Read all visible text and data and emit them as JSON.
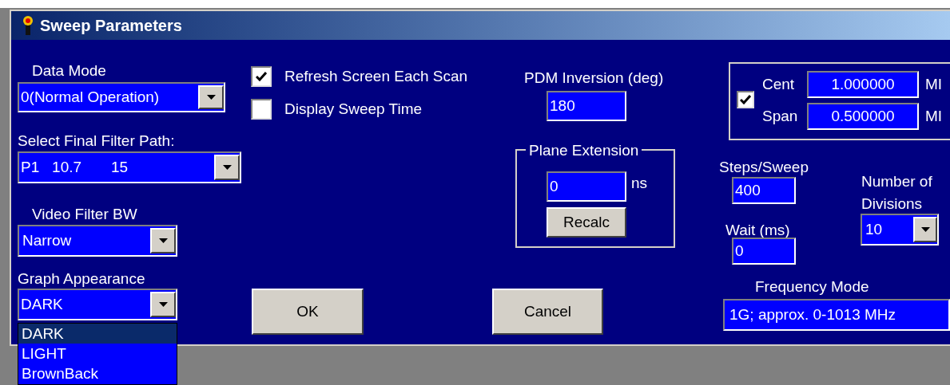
{
  "window": {
    "title": "Sweep Parameters"
  },
  "data_mode": {
    "label": "Data Mode",
    "value": "0(Normal Operation)"
  },
  "final_filter_path": {
    "label": "Select Final Filter Path:",
    "value": "P1   10.7       15"
  },
  "video_filter_bw": {
    "label": "Video Filter BW",
    "value": "Narrow"
  },
  "graph_appearance": {
    "label": "Graph Appearance",
    "value": "DARK",
    "expanded": true,
    "options": [
      {
        "label": "DARK",
        "selected": true
      },
      {
        "label": "LIGHT",
        "selected": false
      },
      {
        "label": "BrownBack",
        "selected": false
      }
    ]
  },
  "checkboxes": [
    {
      "label": "Refresh Screen Each Scan",
      "checked": true
    },
    {
      "label": "Display Sweep Time",
      "checked": false
    }
  ],
  "pdm_inversion": {
    "label": "PDM Inversion (deg)",
    "value": "180"
  },
  "plane_extension": {
    "title": "Plane Extension",
    "value": "0",
    "unit": "ns",
    "button": "Recalc"
  },
  "sweep_range": {
    "checked": true,
    "rows": [
      {
        "label": "Cent",
        "value": "1.000000",
        "unit": "MI"
      },
      {
        "label": "Span",
        "value": "0.500000",
        "unit": "MI"
      }
    ]
  },
  "steps_per_sweep": {
    "label": "Steps/Sweep",
    "value": "400"
  },
  "wait": {
    "label": "Wait (ms)",
    "value": "0"
  },
  "divisions": {
    "label_lines": [
      "Number of",
      "Divisions"
    ],
    "value": "10"
  },
  "frequency_mode": {
    "label": "Frequency Mode",
    "value": "1G; approx. 0-1013 MHz"
  },
  "buttons": [
    {
      "label": "OK"
    },
    {
      "label": "Cancel"
    }
  ]
}
